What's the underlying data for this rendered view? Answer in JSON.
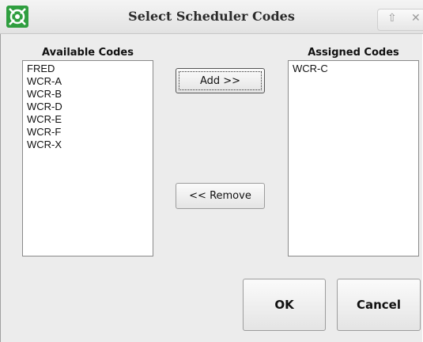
{
  "window": {
    "title": "Select Scheduler Codes",
    "title_buttons": [
      "up-arrow-icon",
      "close-icon"
    ]
  },
  "available": {
    "label": "Available Codes",
    "items": [
      "FRED",
      "WCR-A",
      "WCR-B",
      "WCR-D",
      "WCR-E",
      "WCR-F",
      "WCR-X"
    ]
  },
  "assigned": {
    "label": "Assigned Codes",
    "items": [
      "WCR-C"
    ]
  },
  "buttons": {
    "add": "Add >>",
    "remove": "<< Remove",
    "ok": "OK",
    "cancel": "Cancel"
  },
  "colors": {
    "app_icon_green": "#2f9e3f",
    "dialog_bg": "#ececec"
  }
}
